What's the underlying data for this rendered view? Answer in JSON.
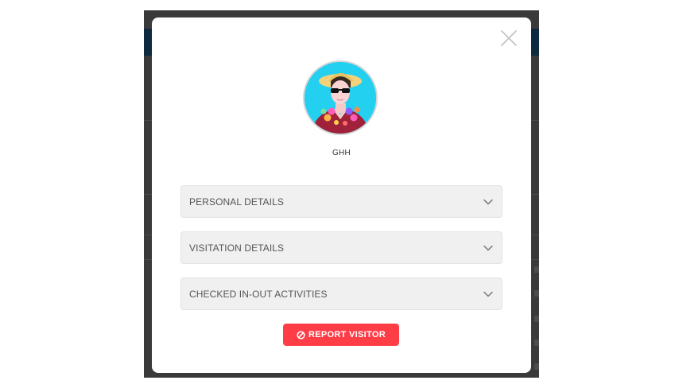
{
  "visitor": {
    "name": "GHH"
  },
  "sections": [
    {
      "label": "PERSONAL DETAILS"
    },
    {
      "label": "VISITATION DETAILS"
    },
    {
      "label": "CHECKED IN-OUT ACTIVITIES"
    }
  ],
  "actions": {
    "report_label": "REPORT VISITOR"
  },
  "icons": {
    "close": "close-icon",
    "chevron": "chevron-down-icon",
    "report": "ban-icon"
  },
  "colors": {
    "report_button": "#ff3d47",
    "accordion_bg": "#f0f0f0",
    "overlay": "#3a3a3a",
    "app_header": "#0e2a3f",
    "avatar_bg": "#24d0f0"
  }
}
